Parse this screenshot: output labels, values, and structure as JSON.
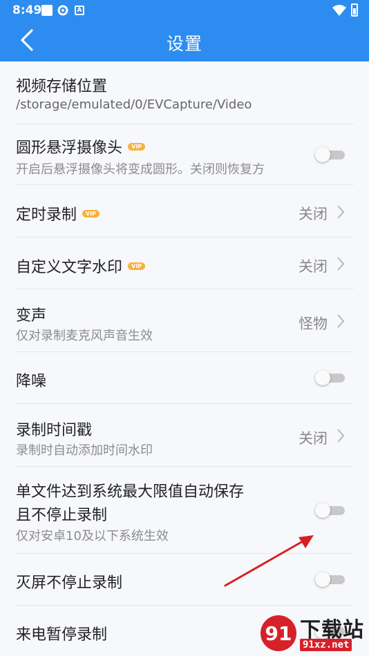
{
  "status_bar": {
    "time": "8:49"
  },
  "header": {
    "title": "设置"
  },
  "settings": [
    {
      "title": "视频存储位置",
      "subtitle": "/storage/emulated/0/EVCapture/Video"
    },
    {
      "title": "圆形悬浮摄像头",
      "vip": "VIP",
      "subtitle": "开启后悬浮摄像头将变成圆形。关闭则恢复方",
      "toggle": "off"
    },
    {
      "title": "定时录制",
      "vip": "VIP",
      "value": "关闭"
    },
    {
      "title": "自定义文字水印",
      "vip": "VIP",
      "value": "关闭"
    },
    {
      "title": "变声",
      "subtitle": "仅对录制麦克风声音生效",
      "value": "怪物"
    },
    {
      "title": "降噪",
      "toggle": "off"
    },
    {
      "title": "录制时间戳",
      "subtitle": "录制时自动添加时间水印",
      "value": "关闭"
    },
    {
      "title_line1": "单文件达到系统最大限值自动保存",
      "title_line2": "且不停止录制",
      "subtitle": "仅对安卓10及以下系统生效",
      "toggle": "off"
    },
    {
      "title": "灭屏不停止录制",
      "toggle": "off"
    },
    {
      "title": "来电暂停录制",
      "toggle": "off"
    }
  ],
  "watermark": {
    "brand": "下载站",
    "domain": "91xz.net"
  },
  "colors": {
    "header": "#2d8cf0",
    "vip_badge": "#f9b23a",
    "arrow": "#d62020"
  },
  "icons": [
    "back-arrow-icon",
    "chevron-right-icon",
    "wifi-icon",
    "battery-icon"
  ]
}
